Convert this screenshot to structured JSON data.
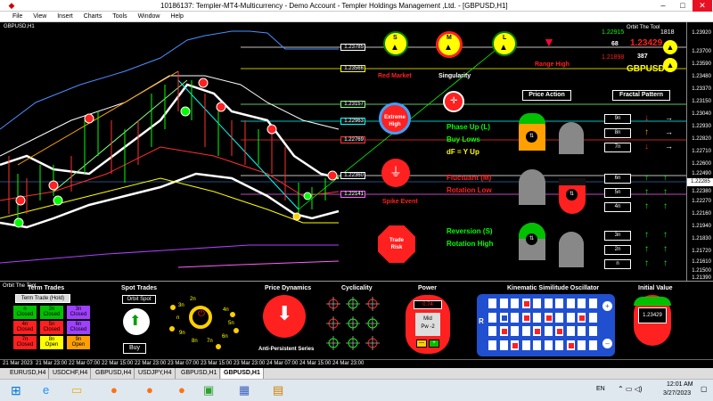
{
  "window": {
    "title": "10186137: Templer-MT4-Multicurrency - Demo Account - Templer Holdings Management ,Ltd. - [GBPUSD,H1]"
  },
  "menu": [
    "File",
    "View",
    "Insert",
    "Charts",
    "Tools",
    "Window",
    "Help"
  ],
  "chart": {
    "symbol_label": "GBPUSD,H1",
    "price_ticks": [
      "1.23920",
      "1.23700",
      "1.23590",
      "1.23480",
      "1.23370",
      "1.23150",
      "1.23040",
      "1.22930",
      "1.22820",
      "1.22710",
      "1.22600",
      "1.22490",
      "1.22380",
      "1.22270",
      "1.22160",
      "1.21940",
      "1.21830",
      "1.21720",
      "1.21610",
      "1.21500",
      "1.21390"
    ],
    "level_labels": [
      "1.23785",
      "1.23566",
      "1.23157",
      "1.22963",
      "1.22769",
      "1.22360",
      "1.22141"
    ],
    "current_price": "1.22285",
    "time_ticks": [
      "21 Mar 2023",
      "21 Mar 23:00",
      "22 Mar 07:00",
      "22 Mar 15:00",
      "22 Mar 23:00",
      "23 Mar 07:00",
      "23 Mar 15:00",
      "23 Mar 23:00",
      "24 Mar 07:00",
      "24 Mar 15:00",
      "24 Mar 23:00"
    ]
  },
  "orbit_header": {
    "label": "Orbit The Tool",
    "v1": "1.22915",
    "v2": "1.23429",
    "v3": "68",
    "v4": "387",
    "v5": "1.21898",
    "ratio": "1818",
    "symbol": "GBPUSD"
  },
  "signals": {
    "red_market": "Red Market",
    "singularity": "Singularity",
    "range_high": "Range High",
    "extreme_high_1": "Extreme",
    "extreme_high_2": "High",
    "spike_event": "Spike Event",
    "trade_risk_1": "Trade",
    "trade_risk_2": "Risk",
    "ball_letters": [
      "S",
      "M",
      "L"
    ]
  },
  "phase": {
    "phase_up": "Phase Up (L)",
    "buy_lows": "Buy Lows",
    "df": "dF = Y Up",
    "fluctuant": "Fluctuant (M)",
    "rotation_low": "Rotation Low",
    "reversion": "Reversion (S)",
    "rotation_high": "Rotation High"
  },
  "price_action": {
    "title": "Price Action"
  },
  "fractal": {
    "title": "Fractal Pattern",
    "rows": [
      "9n",
      "8n",
      "7n",
      "6n",
      "5n",
      "4n",
      "3n",
      "2n",
      "n"
    ]
  },
  "bottom": {
    "orbit_label": "Orbit The Tool",
    "term_trades": {
      "title": "Term Trades",
      "hold": "Term Trade (Hold)",
      "cells": [
        {
          "n": "n",
          "s": "Closed",
          "c": "#00c000"
        },
        {
          "n": "4n",
          "s": "Closed",
          "c": "#ff2020"
        },
        {
          "n": "7n",
          "s": "Closed",
          "c": "#ff2020"
        },
        {
          "n": "2n",
          "s": "Closed",
          "c": "#00c000"
        },
        {
          "n": "5n",
          "s": "Closed",
          "c": "#ff2020"
        },
        {
          "n": "8n",
          "s": "Open",
          "c": "#ffff00"
        },
        {
          "n": "3n",
          "s": "Closed",
          "c": "#a040ff"
        },
        {
          "n": "6n",
          "s": "Closed",
          "c": "#a040ff"
        },
        {
          "n": "9n",
          "s": "Open",
          "c": "#ffa000"
        }
      ]
    },
    "spot_trades": {
      "title": "Spot Trades",
      "orbit_spot": "Orbit Spot",
      "buy": "Buy"
    },
    "dial_labels": [
      "2n",
      "4n",
      "5n",
      "6n",
      "7n",
      "8n",
      "9n",
      "n",
      "3n"
    ],
    "price_dynamics": {
      "title": "Price Dynamics",
      "footer": "Anti-Persistent Series"
    },
    "cyclicality": {
      "title": "Cyclicality"
    },
    "power": {
      "title": "Power",
      "value": "0.74",
      "mid": "Mid",
      "pw": "Pw -2",
      "minus": "—",
      "plus": "+"
    },
    "kso": {
      "title": "Kinematic Similitude Oscillator",
      "side": "R"
    },
    "initial_value": {
      "title": "Initial Value",
      "value": "1.23429"
    }
  },
  "tabs": [
    "EURUSD,H4",
    "USDCHF,H4",
    "GBPUSD,H4",
    "USDJPY,H4",
    "GBPUSD,H1",
    "GBPUSD,H1"
  ],
  "taskbar": {
    "lang": "EN",
    "time": "12:01 AM",
    "date": "3/27/2023"
  }
}
